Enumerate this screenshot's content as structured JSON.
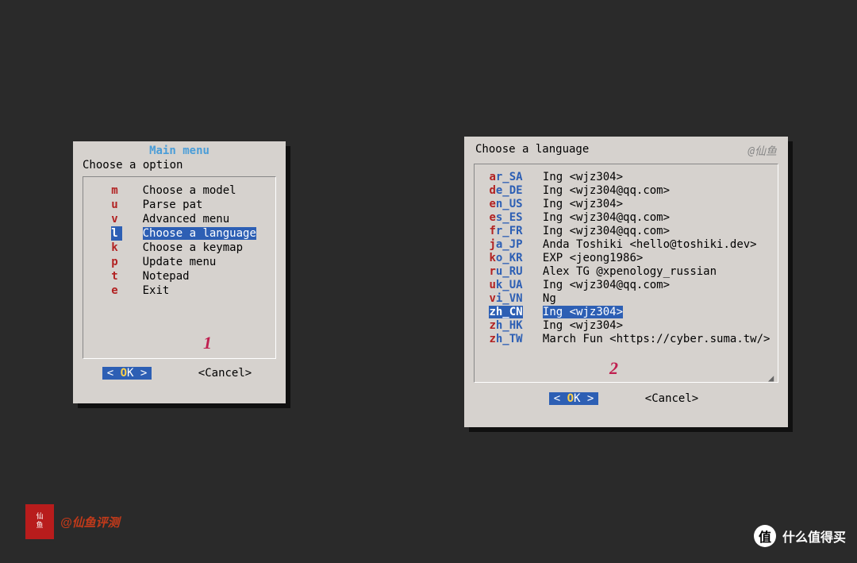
{
  "dialog1": {
    "title": "Main menu",
    "prompt": "Choose a option",
    "items": [
      {
        "key": "m",
        "label": "Choose a model",
        "selected": false
      },
      {
        "key": "u",
        "label": "Parse pat",
        "selected": false
      },
      {
        "key": "v",
        "label": "Advanced menu",
        "selected": false
      },
      {
        "key": "l",
        "label": "Choose a language",
        "selected": true
      },
      {
        "key": "k",
        "label": "Choose a keymap",
        "selected": false
      },
      {
        "key": "p",
        "label": "Update menu",
        "selected": false
      },
      {
        "key": "t",
        "label": "Notepad",
        "selected": false
      },
      {
        "key": "e",
        "label": "Exit",
        "selected": false
      }
    ],
    "annotation": "1",
    "ok": "OK",
    "cancel": "Cancel"
  },
  "dialog2": {
    "prompt": "Choose a language",
    "watermark": "@仙鱼",
    "items": [
      {
        "code": "ar_SA",
        "author": "Ing <wjz304>",
        "selected": false
      },
      {
        "code": "de_DE",
        "author": "Ing <wjz304@qq.com>",
        "selected": false
      },
      {
        "code": "en_US",
        "author": "Ing <wjz304>",
        "selected": false
      },
      {
        "code": "es_ES",
        "author": "Ing <wjz304@qq.com>",
        "selected": false
      },
      {
        "code": "fr_FR",
        "author": "Ing <wjz304@qq.com>",
        "selected": false
      },
      {
        "code": "ja_JP",
        "author": "Anda Toshiki <hello@toshiki.dev>",
        "selected": false
      },
      {
        "code": "ko_KR",
        "author": "EXP <jeong1986>",
        "selected": false
      },
      {
        "code": "ru_RU",
        "author": "Alex TG @xpenology_russian",
        "selected": false
      },
      {
        "code": "uk_UA",
        "author": "Ing <wjz304@qq.com>",
        "selected": false
      },
      {
        "code": "vi_VN",
        "author": "Ng",
        "selected": false
      },
      {
        "code": "zh_CN",
        "author": "Ing <wjz304>",
        "selected": true
      },
      {
        "code": "zh_HK",
        "author": "Ing <wjz304>",
        "selected": false
      },
      {
        "code": "zh_TW",
        "author": "March Fun <https://cyber.suma.tw/>",
        "selected": false
      }
    ],
    "annotation": "2",
    "ok": "OK",
    "cancel": "Cancel"
  },
  "footer": {
    "stamp_text": "@仙鱼评测",
    "smzdm": "什么值得买",
    "smzdm_badge": "值"
  }
}
